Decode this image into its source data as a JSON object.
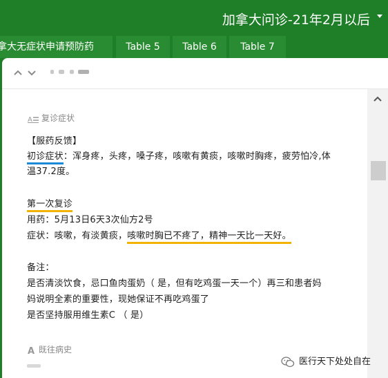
{
  "app": {
    "title": "加拿大问诊-21年2月以后"
  },
  "tabs": [
    {
      "label": "拿大无症状申请预防药"
    },
    {
      "label": "Table 5"
    },
    {
      "label": "Table 6"
    },
    {
      "label": "Table 7"
    }
  ],
  "sections": {
    "followup_label": "复诊症状",
    "history_label": "既往病史"
  },
  "record": {
    "feedback_heading": "【服药反馈】",
    "initial_label": "初诊症状",
    "initial_text_1": "：浑身疼，头疼，嗓子疼，咳嗽有黄痰，咳嗽时胸疼，疲劳怕冷,体",
    "initial_text_2": "温37.2度。",
    "first_followup": "第一次复诊",
    "medication": "用药：5月13日6天3次仙方2号",
    "symptom_prefix": "症状：咳嗽，有淡黄痰，",
    "symptom_highlight": "咳嗽时胸已不疼了，精神一天比一天好。",
    "notes_heading": "备注：",
    "note_1": "是否清淡饮食，忌口鱼肉蛋奶（   是，但有吃鸡蛋一天一个）再三和患者妈",
    "note_2": "妈说明全素的重要性，现她保证不再吃鸡蛋了",
    "note_3": "是否坚持服用维生素C （   是）"
  },
  "watermark": {
    "text": "医行天下处处自在"
  },
  "colors": {
    "header_green": "#1f7f28",
    "underline_blue": "#1a8ad6",
    "underline_yellow": "#f2b300"
  }
}
